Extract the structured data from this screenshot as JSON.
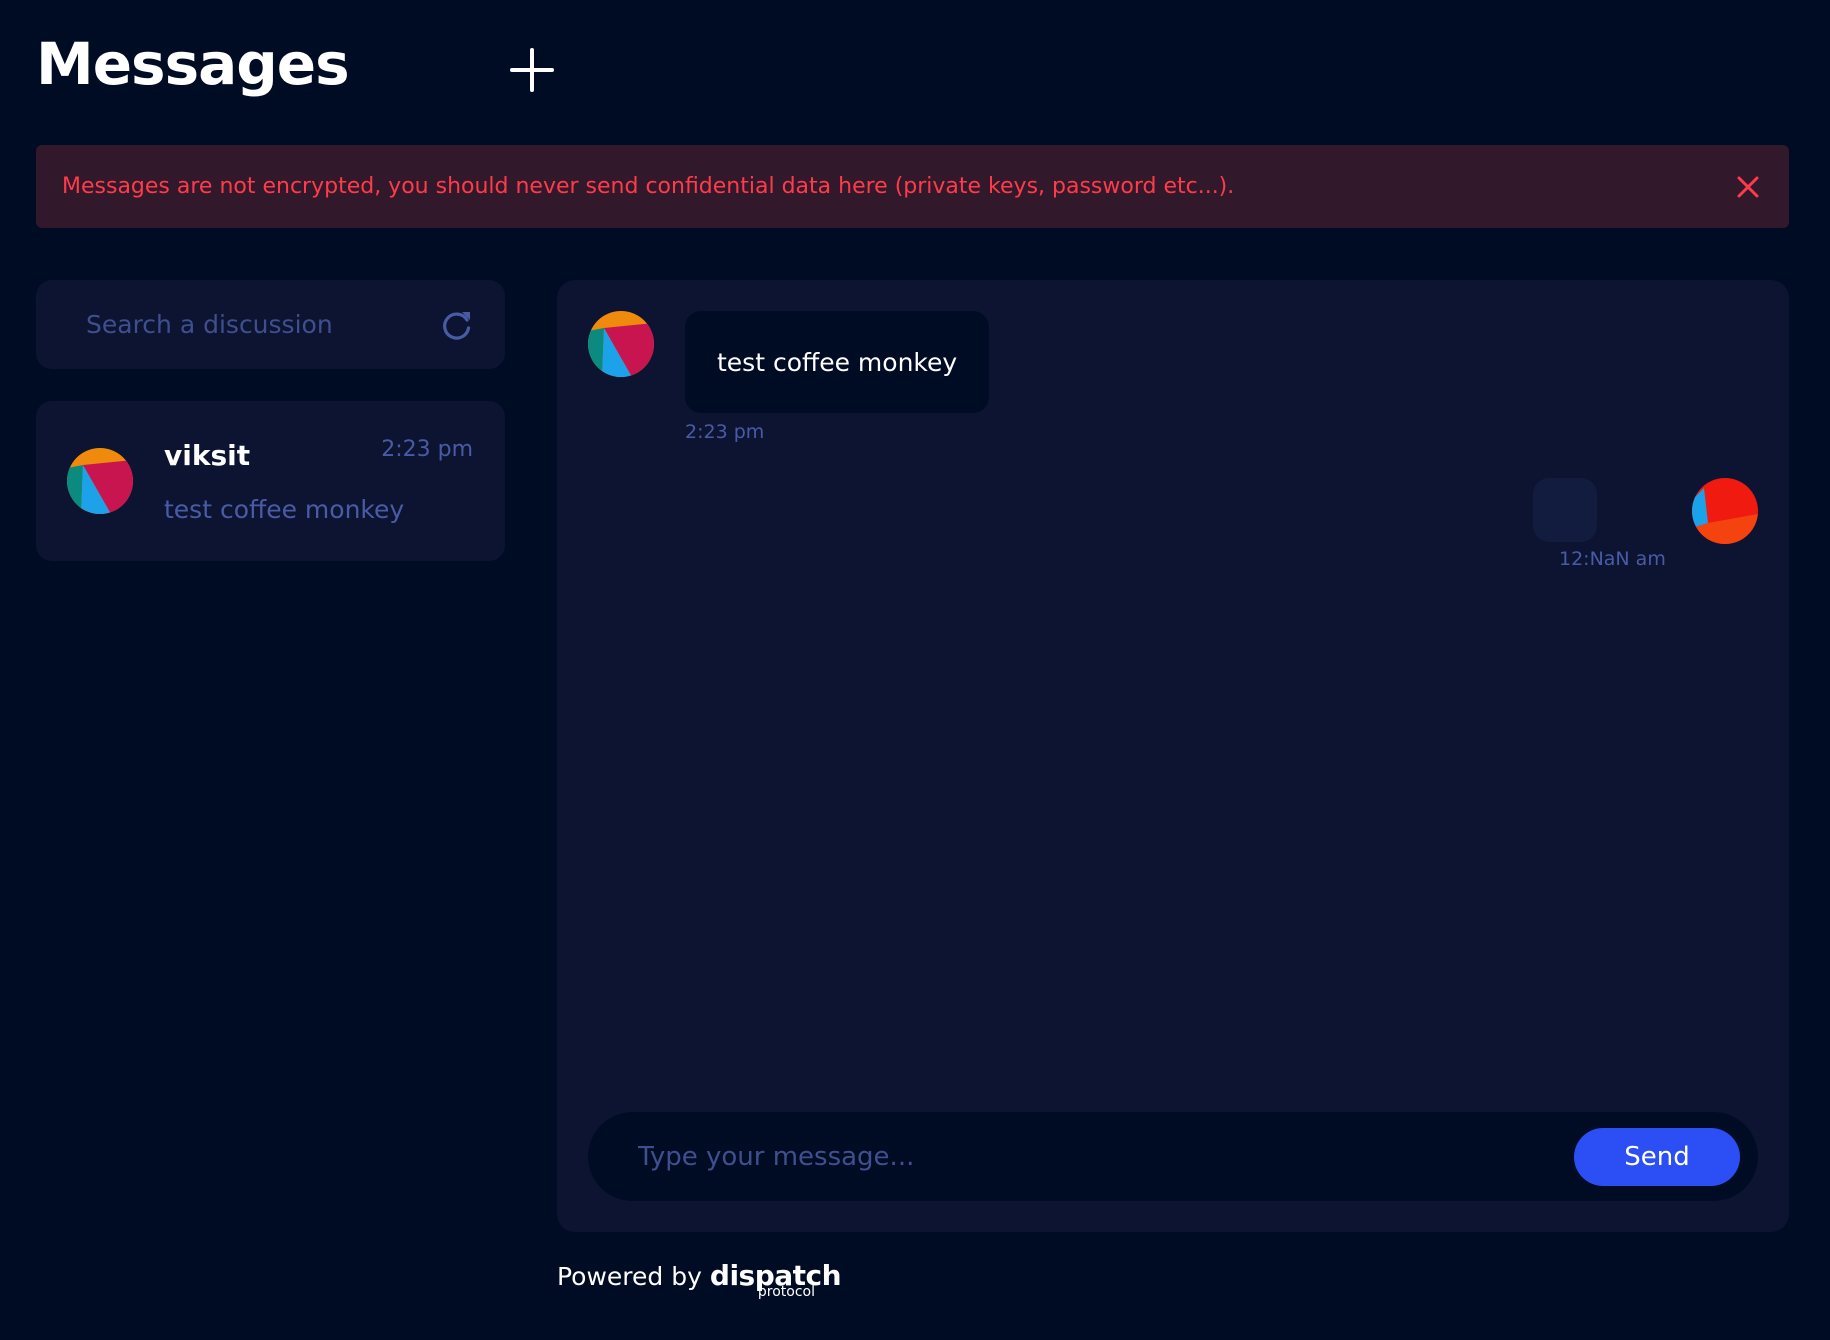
{
  "header": {
    "title": "Messages",
    "new_icon": "plus-icon"
  },
  "warning": {
    "text": "Messages are not encrypted, you should never send confidential data here (private keys, password etc...).",
    "close_icon": "close-icon",
    "color": "#ff3b4a",
    "background": "#31192b"
  },
  "sidebar": {
    "search": {
      "placeholder": "Search a discussion",
      "value": "",
      "refresh_icon": "refresh-icon"
    },
    "conversations": [
      {
        "name": "viksit",
        "time": "2:23 pm",
        "preview": "test coffee monkey",
        "avatar": "avatar-multicolor"
      }
    ]
  },
  "chat": {
    "messages": [
      {
        "side": "left",
        "text": "test coffee monkey",
        "time": "2:23 pm",
        "avatar": "avatar-multicolor"
      },
      {
        "side": "right",
        "text": "",
        "time": "12:NaN am",
        "avatar": "avatar-red"
      }
    ],
    "composer": {
      "placeholder": "Type your message...",
      "value": "",
      "send_label": "Send"
    }
  },
  "footer": {
    "powered_by": "Powered by",
    "brand": "dispatch",
    "brand_sub": "protocol"
  },
  "colors": {
    "background": "#000c24",
    "panel": "#0c1431",
    "accent": "#2b4ef5",
    "muted_text": "#4a5ba6"
  }
}
